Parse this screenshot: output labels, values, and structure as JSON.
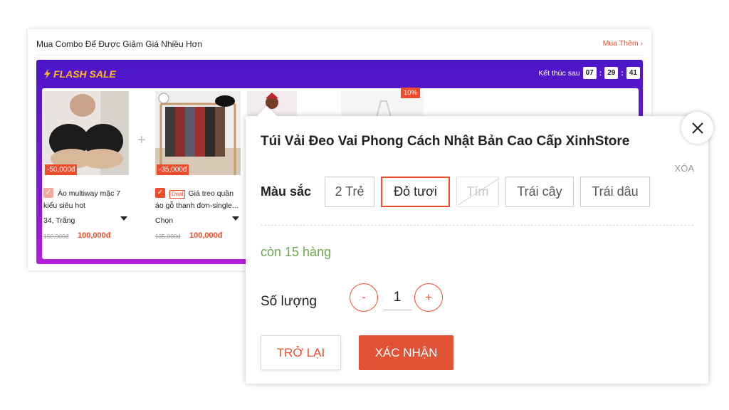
{
  "combo": {
    "header": "Mua Combo Để Được Giảm Giá Nhiều Hơn",
    "more_link": "Mua Thêm",
    "flash_sale": {
      "title": "FLASH SALE",
      "ends_label": "Kết thúc sau",
      "countdown": {
        "hours": "07",
        "minutes": "29",
        "seconds": "41"
      }
    },
    "products": [
      {
        "discount": "-50,000đ",
        "name": "Áo multiway mặc 7 kiểu siêu hot",
        "variant": "34, Trắng",
        "old_price": "150,000đ",
        "new_price": "100,000đ"
      },
      {
        "discount": "-35,000đ",
        "deal_badge": "Deal",
        "name": "Giá treo quần áo gỗ thanh đơn-single...",
        "variant": "Chọn",
        "old_price": "135,000đ",
        "new_price": "100,000đ"
      },
      {
        "discount_pct": "10%"
      }
    ]
  },
  "modal": {
    "title": "Túi Vải Đeo Vai Phong Cách Nhật Bản Cao Cấp XinhStore",
    "clear": "XÓA",
    "color_label": "Màu sắc",
    "colors": [
      {
        "label": "2 Trẻ",
        "state": "normal"
      },
      {
        "label": "Đỏ tươi",
        "state": "selected"
      },
      {
        "label": "Tím",
        "state": "disabled"
      },
      {
        "label": "Trái cây",
        "state": "normal"
      },
      {
        "label": "Trái dâu",
        "state": "normal"
      }
    ],
    "stock": "còn 15 hàng",
    "quantity_label": "Số lượng",
    "quantity": "1",
    "minus": "-",
    "plus": "+",
    "back_button": "TRỞ LẠI",
    "confirm_button": "XÁC NHẬN"
  },
  "icons": {
    "bolt_color": "#ffb61e",
    "accent": "#ee4d2d",
    "stock_color": "#6aa84f"
  }
}
